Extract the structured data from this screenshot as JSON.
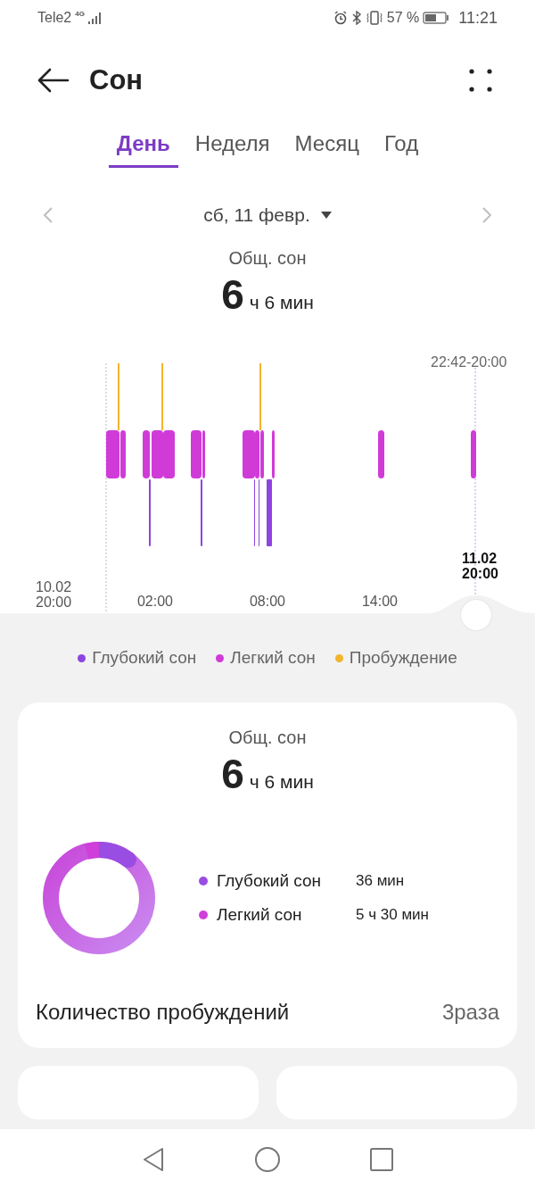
{
  "status_bar": {
    "carrier": "Tele2",
    "network": "4G",
    "battery": "57 %",
    "time": "11:21"
  },
  "header": {
    "title": "Сон"
  },
  "tabs": [
    {
      "label": "День",
      "selected": true
    },
    {
      "label": "Неделя",
      "selected": false
    },
    {
      "label": "Месяц",
      "selected": false
    },
    {
      "label": "Год",
      "selected": false
    }
  ],
  "date": "сб, 11 февр.",
  "summary": {
    "label": "Общ. сон",
    "hours": "6",
    "rest": "ч 6 мин"
  },
  "chart": {
    "range": "22:42-20:00",
    "start": [
      "10.02",
      "20:00"
    ],
    "ticks": [
      "02:00",
      "08:00",
      "14:00"
    ],
    "end": [
      "11.02",
      "20:00"
    ]
  },
  "legend": [
    {
      "label": "Глубокий сон",
      "color": "#8e44e0"
    },
    {
      "label": "Легкий сон",
      "color": "#d03bd8"
    },
    {
      "label": "Пробуждение",
      "color": "#f2b52c"
    }
  ],
  "card": {
    "label": "Общ. сон",
    "hours": "6",
    "rest": "ч 6 мин",
    "stages": [
      {
        "label": "Глубокий сон",
        "value": "36 мин",
        "color": "#9a4de2"
      },
      {
        "label": "Легкий сон",
        "value": "5 ч 30 мин",
        "color": "#cf3fd9"
      }
    ],
    "wakeups_label": "Количество пробуждений",
    "wakeups_value": "3раза"
  }
}
